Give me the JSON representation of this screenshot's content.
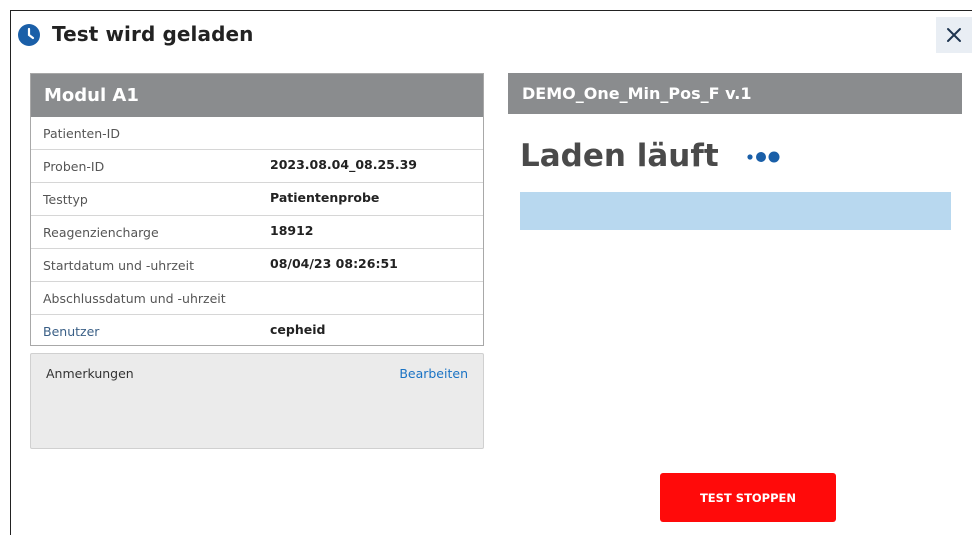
{
  "dialog": {
    "title": "Test wird geladen",
    "close_label": "×"
  },
  "module": {
    "header": "Modul A1",
    "rows": [
      {
        "label": "Patienten-ID",
        "value": ""
      },
      {
        "label": "Proben-ID",
        "value": "2023.08.04_08.25.39"
      },
      {
        "label": "Testtyp",
        "value": "Patientenprobe"
      },
      {
        "label": "Reagenziencharge",
        "value": "18912"
      },
      {
        "label": "Startdatum und -uhrzeit",
        "value": "08/04/23 08:26:51"
      },
      {
        "label": "Abschlussdatum und -uhrzeit",
        "value": ""
      },
      {
        "label": "Benutzer",
        "value": "cepheid"
      }
    ]
  },
  "notes": {
    "label": "Anmerkungen",
    "edit_label": "Bearbeiten"
  },
  "test": {
    "name": "DEMO_One_Min_Pos_F v.1",
    "status": "Laden läuft",
    "progress": 0,
    "stop_label": "TEST STOPPEN"
  },
  "colors": {
    "header_gray": "#8a8c8e",
    "progress_blue": "#b8d8ef",
    "stop_red": "#ff0a0a",
    "accent_blue": "#1a5fa8"
  },
  "icons": {
    "title": "clock-icon",
    "close": "close-icon",
    "loading": "loading-dots-icon"
  }
}
